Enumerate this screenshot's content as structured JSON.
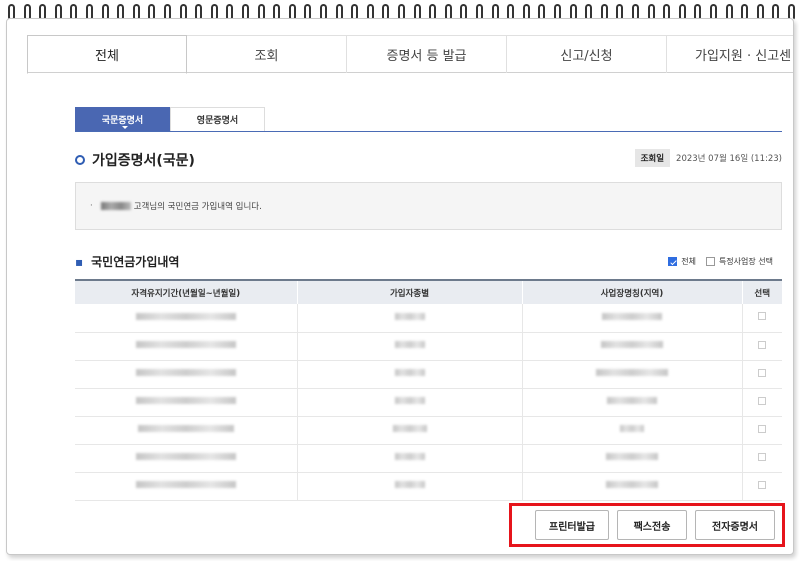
{
  "top_tabs": [
    "전체",
    "조회",
    "증명서 등 발급",
    "신고/신청",
    "가입지원 · 신고센"
  ],
  "sub_tabs": [
    "국문증명서",
    "영문증명서"
  ],
  "section_title": "가입증명서(국문)",
  "query_date": {
    "label": "조회일",
    "value": "2023년 07월 16일 (11:23)"
  },
  "info_text": "고객님의 국민연금 가입내역 입니다.",
  "list": {
    "title": "국민연금가입내역",
    "filter_all": "전체",
    "filter_specific": "특정사업장 선택",
    "columns": [
      "자격유지기간(년월일~년월일)",
      "가입자종별",
      "사업장명칭(지역)",
      "선택"
    ]
  },
  "buttons": {
    "print": "프린터발급",
    "fax": "팩스전송",
    "electronic": "전자증명서"
  }
}
